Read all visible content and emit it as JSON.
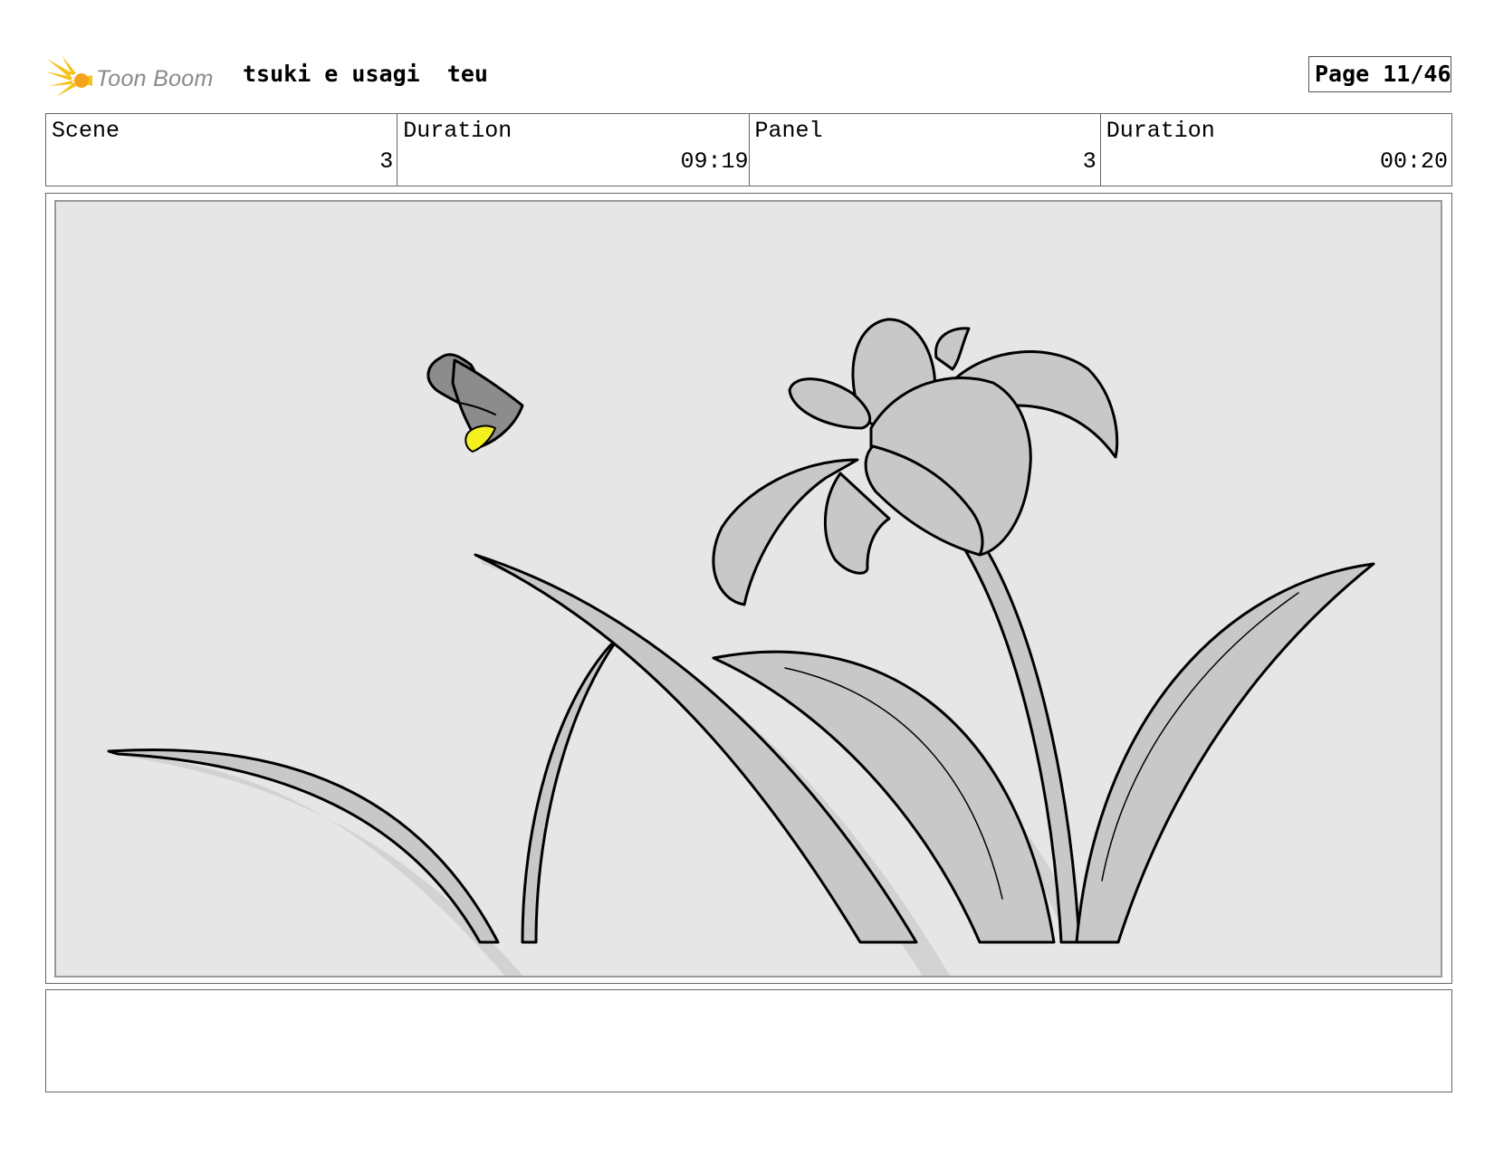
{
  "header": {
    "logo_text": "Toon Boom",
    "title": "tsuki e usagi  teu",
    "page": "Page 11/46"
  },
  "info": {
    "scene_label": "Scene",
    "scene_value": "3",
    "scene_duration_label": "Duration",
    "scene_duration_value": "09:19",
    "panel_label": "Panel",
    "panel_value": "3",
    "panel_duration_label": "Duration",
    "panel_duration_value": "00:20"
  },
  "notes": {
    "text": ""
  },
  "colors": {
    "canvas_bg": "#e6e6e6",
    "plant_fill": "#c8c8c8",
    "shadow": "#d2d2d2",
    "firefly_body": "#8c8c8c",
    "firefly_glow": "#f5f020",
    "logo_star": "#f7c21a",
    "logo_text": "#8a8a8a"
  }
}
